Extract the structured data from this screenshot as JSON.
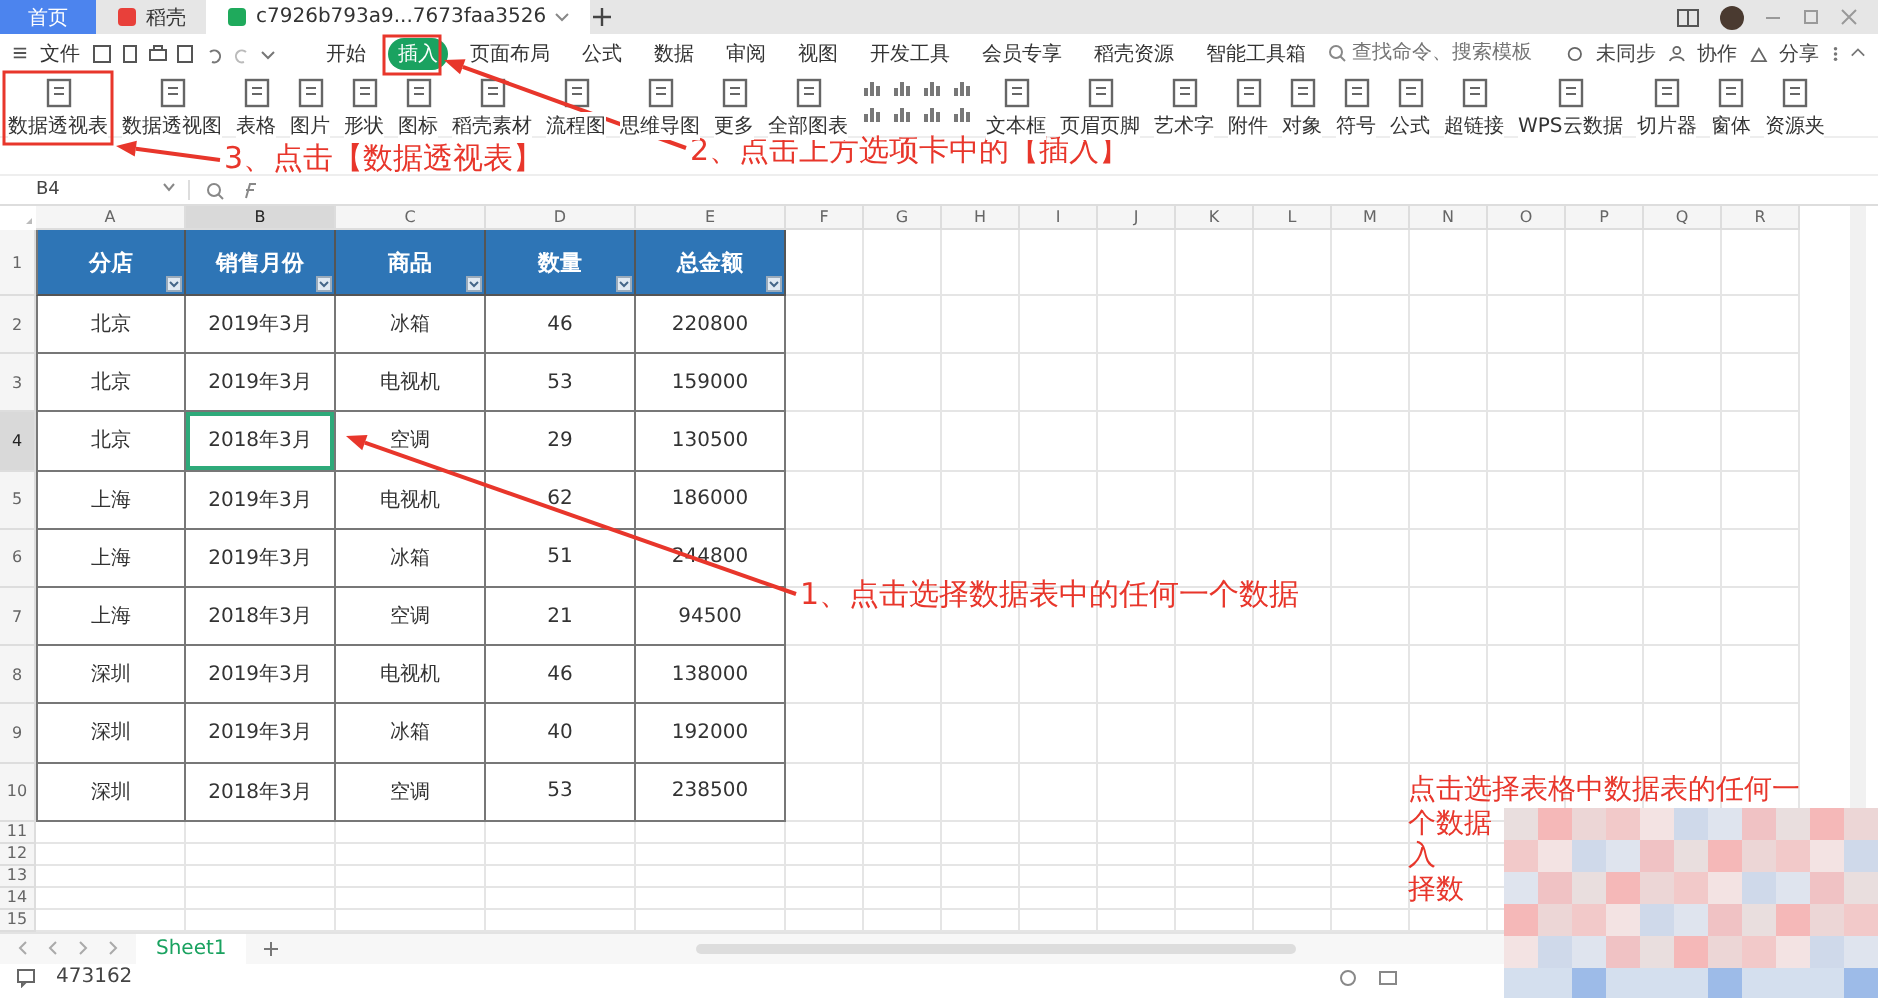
{
  "title_tabs": [
    {
      "label": "首页",
      "kind": "home",
      "selected": false
    },
    {
      "label": "稻壳",
      "kind": "docer",
      "selected": false
    },
    {
      "label": "c7926b793a9...7673faa3526",
      "kind": "file",
      "selected": true
    }
  ],
  "menu": {
    "file_label": "文件",
    "tabs": [
      {
        "label": "开始",
        "selected": false
      },
      {
        "label": "插入",
        "selected": true
      },
      {
        "label": "页面布局",
        "selected": false
      },
      {
        "label": "公式",
        "selected": false
      },
      {
        "label": "数据",
        "selected": false
      },
      {
        "label": "审阅",
        "selected": false
      },
      {
        "label": "视图",
        "selected": false
      },
      {
        "label": "开发工具",
        "selected": false
      },
      {
        "label": "会员专享",
        "selected": false
      },
      {
        "label": "稻壳资源",
        "selected": false
      },
      {
        "label": "智能工具箱",
        "selected": false
      }
    ],
    "search": {
      "placeholder": "查找命令、搜索模板"
    },
    "actions": [
      "未同步",
      "协作",
      "分享"
    ]
  },
  "ribbon": [
    "数据透视表",
    "数据透视图",
    "表格",
    "图片",
    "形状",
    "图标",
    "稻壳素材",
    "流程图",
    "思维导图",
    "更多",
    "全部图表",
    "文本框",
    "页眉页脚",
    "艺术字",
    "附件",
    "对象",
    "符号",
    "公式",
    "超链接",
    "WPS云数据",
    "切片器",
    "窗体",
    "资源夹"
  ],
  "name_box": "B4",
  "columns": [
    {
      "label": "A",
      "selected": false
    },
    {
      "label": "B",
      "selected": true
    },
    {
      "label": "C",
      "selected": false
    },
    {
      "label": "D",
      "selected": false
    },
    {
      "label": "E",
      "selected": false
    },
    {
      "label": "F",
      "selected": false
    },
    {
      "label": "G",
      "selected": false
    },
    {
      "label": "H",
      "selected": false
    },
    {
      "label": "I",
      "selected": false
    },
    {
      "label": "J",
      "selected": false
    },
    {
      "label": "K",
      "selected": false
    },
    {
      "label": "L",
      "selected": false
    },
    {
      "label": "M",
      "selected": false
    },
    {
      "label": "N",
      "selected": false
    },
    {
      "label": "O",
      "selected": false
    },
    {
      "label": "P",
      "selected": false
    },
    {
      "label": "Q",
      "selected": false
    },
    {
      "label": "R",
      "selected": false
    }
  ],
  "table": {
    "header_row": "1",
    "headers": [
      "分店",
      "销售月份",
      "商品",
      "数量",
      "总金额"
    ],
    "rows": [
      {
        "number": "2",
        "selected": false,
        "cells": [
          {
            "text": "北京",
            "selected": false
          },
          {
            "text": "2019年3月",
            "selected": false
          },
          {
            "text": "冰箱",
            "selected": false
          },
          {
            "text": "46",
            "selected": false
          },
          {
            "text": "220800",
            "selected": false
          }
        ]
      },
      {
        "number": "3",
        "selected": false,
        "cells": [
          {
            "text": "北京",
            "selected": false
          },
          {
            "text": "2019年3月",
            "selected": false
          },
          {
            "text": "电视机",
            "selected": false
          },
          {
            "text": "53",
            "selected": false
          },
          {
            "text": "159000",
            "selected": false
          }
        ]
      },
      {
        "number": "4",
        "selected": true,
        "cells": [
          {
            "text": "北京",
            "selected": false
          },
          {
            "text": "2018年3月",
            "selected": true
          },
          {
            "text": "空调",
            "selected": false
          },
          {
            "text": "29",
            "selected": false
          },
          {
            "text": "130500",
            "selected": false
          }
        ]
      },
      {
        "number": "5",
        "selected": false,
        "cells": [
          {
            "text": "上海",
            "selected": false
          },
          {
            "text": "2019年3月",
            "selected": false
          },
          {
            "text": "电视机",
            "selected": false
          },
          {
            "text": "62",
            "selected": false
          },
          {
            "text": "186000",
            "selected": false
          }
        ]
      },
      {
        "number": "6",
        "selected": false,
        "cells": [
          {
            "text": "上海",
            "selected": false
          },
          {
            "text": "2019年3月",
            "selected": false
          },
          {
            "text": "冰箱",
            "selected": false
          },
          {
            "text": "51",
            "selected": false
          },
          {
            "text": "244800",
            "selected": false
          }
        ]
      },
      {
        "number": "7",
        "selected": false,
        "cells": [
          {
            "text": "上海",
            "selected": false
          },
          {
            "text": "2018年3月",
            "selected": false
          },
          {
            "text": "空调",
            "selected": false
          },
          {
            "text": "21",
            "selected": false
          },
          {
            "text": "94500",
            "selected": false
          }
        ]
      },
      {
        "number": "8",
        "selected": false,
        "cells": [
          {
            "text": "深圳",
            "selected": false
          },
          {
            "text": "2019年3月",
            "selected": false
          },
          {
            "text": "电视机",
            "selected": false
          },
          {
            "text": "46",
            "selected": false
          },
          {
            "text": "138000",
            "selected": false
          }
        ]
      },
      {
        "number": "9",
        "selected": false,
        "cells": [
          {
            "text": "深圳",
            "selected": false
          },
          {
            "text": "2019年3月",
            "selected": false
          },
          {
            "text": "冰箱",
            "selected": false
          },
          {
            "text": "40",
            "selected": false
          },
          {
            "text": "192000",
            "selected": false
          }
        ]
      },
      {
        "number": "10",
        "selected": false,
        "cells": [
          {
            "text": "深圳",
            "selected": false
          },
          {
            "text": "2018年3月",
            "selected": false
          },
          {
            "text": "空调",
            "selected": false
          },
          {
            "text": "53",
            "selected": false
          },
          {
            "text": "238500",
            "selected": false
          }
        ]
      }
    ],
    "empty_rows": [
      "11",
      "12",
      "13",
      "14",
      "15"
    ]
  },
  "sheet_tabs": [
    {
      "label": "Sheet1",
      "selected": true
    }
  ],
  "status": "473162",
  "callouts": [
    "3、点击【数据透视表】",
    "2、点击上方选项卡中的【插入】",
    "1、点击选择数据表中的任何一个数据"
  ],
  "note_lines": [
    "点击选择表格中数据表的任何一",
    "个数据",
    "入",
    "择数"
  ]
}
